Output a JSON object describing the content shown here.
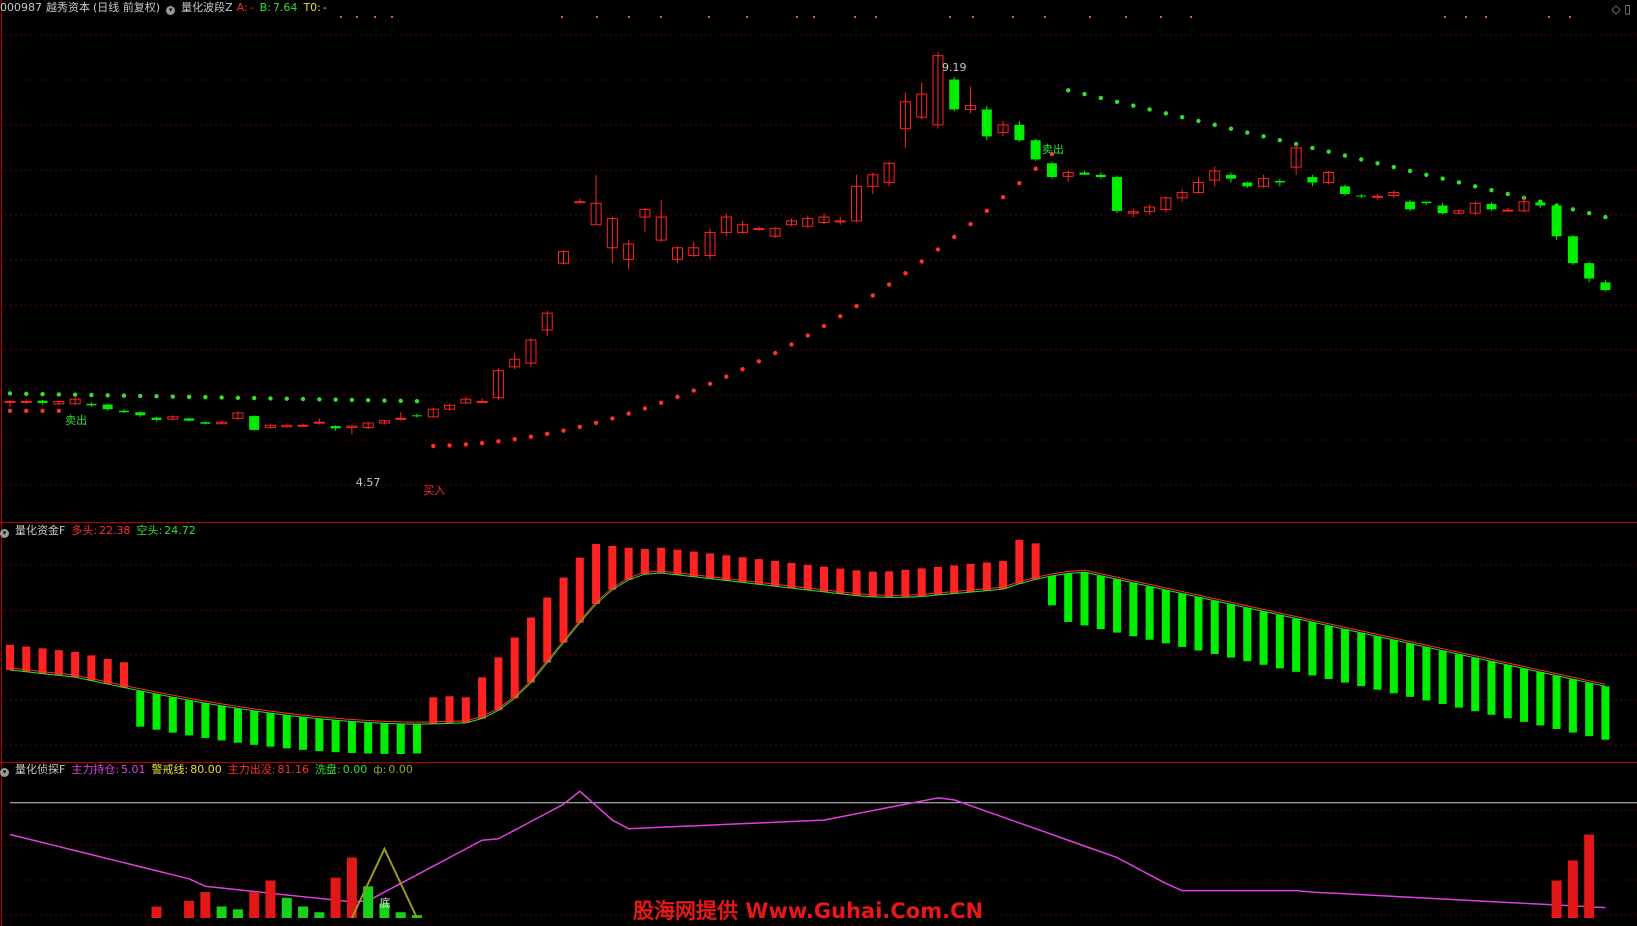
{
  "header": {
    "code": "000987",
    "name": "越秀资本",
    "mode": "(日线 前复权)",
    "indicator": "量化波段Z",
    "a_label": "A:",
    "a_value": "-",
    "b_label": "B:",
    "b_value": "7.64",
    "t0_label": "T0:",
    "t0_value": "-"
  },
  "panel2": {
    "indicator": "量化资金F",
    "long_label": "多头:",
    "long_value": "22.38",
    "short_label": "空头:",
    "short_value": "24.72"
  },
  "panel3": {
    "indicator": "量化侦探F",
    "hold_label": "主力持仓:",
    "hold_value": "5.01",
    "warn_label": "警戒线:",
    "warn_value": "80.00",
    "exit_label": "主力出没:",
    "exit_value": "81.16",
    "wash_label": "洗盘:",
    "wash_value": "0.00",
    "f_label": "ф:",
    "f_value": "0.00"
  },
  "watermark": "股海网提供 Www.Guhai.Com.CN",
  "colors": {
    "up": "#ff2222",
    "down": "#00ee00",
    "magenta": "#e040e0",
    "white": "#cccccc",
    "dotred": "#ff3030",
    "dotgreen": "#30e030",
    "olive": "#9a9a20",
    "bg": "#000000",
    "grid": "#5a0000"
  },
  "chart_data": [
    {
      "type": "candlestick",
      "price_range": [
        3.9,
        9.6
      ],
      "annotations": [
        {
          "text": "9.19",
          "index": 57,
          "value": 9.19
        },
        {
          "text": "4.57",
          "index": 21,
          "value": 4.57
        },
        {
          "text": "买入",
          "index": 26,
          "value": 4.5
        },
        {
          "text": "卖出",
          "index": 4,
          "value": 5.1
        },
        {
          "text": "卖出",
          "index": 64,
          "value": 8.4
        }
      ],
      "candles": [
        [
          5.0,
          5.0,
          5.02,
          4.93
        ],
        [
          5.0,
          5.0,
          5.03,
          4.97
        ],
        [
          5.01,
          4.98,
          5.02,
          4.96
        ],
        [
          4.97,
          5.0,
          5.01,
          4.95
        ],
        [
          4.97,
          5.03,
          5.05,
          4.95
        ],
        [
          4.97,
          4.95,
          4.99,
          4.93
        ],
        [
          4.96,
          4.9,
          4.97,
          4.88
        ],
        [
          4.88,
          4.86,
          4.9,
          4.85
        ],
        [
          4.86,
          4.82,
          4.87,
          4.8
        ],
        [
          4.79,
          4.76,
          4.8,
          4.74
        ],
        [
          4.77,
          4.8,
          4.82,
          4.76
        ],
        [
          4.78,
          4.75,
          4.79,
          4.74
        ],
        [
          4.73,
          4.71,
          4.74,
          4.7
        ],
        [
          4.71,
          4.73,
          4.75,
          4.7
        ],
        [
          4.78,
          4.85,
          4.87,
          4.76
        ],
        [
          4.81,
          4.63,
          4.82,
          4.62
        ],
        [
          4.66,
          4.69,
          4.7,
          4.65
        ],
        [
          4.67,
          4.69,
          4.7,
          4.66
        ],
        [
          4.69,
          4.69,
          4.71,
          4.67
        ],
        [
          4.73,
          4.73,
          4.78,
          4.7
        ],
        [
          4.68,
          4.65,
          4.69,
          4.62
        ],
        [
          4.66,
          4.68,
          4.69,
          4.57
        ],
        [
          4.66,
          4.72,
          4.73,
          4.64
        ],
        [
          4.72,
          4.75,
          4.76,
          4.7
        ],
        [
          4.78,
          4.78,
          4.86,
          4.75
        ],
        [
          4.82,
          4.81,
          4.84,
          4.79
        ],
        [
          4.8,
          4.9,
          4.92,
          4.79
        ],
        [
          4.9,
          4.95,
          4.97,
          4.88
        ],
        [
          4.98,
          5.03,
          5.06,
          4.97
        ],
        [
          5.0,
          5.0,
          5.04,
          4.98
        ],
        [
          5.05,
          5.4,
          5.43,
          5.02
        ],
        [
          5.45,
          5.55,
          5.63,
          5.42
        ],
        [
          5.5,
          5.8,
          5.82,
          5.45
        ],
        [
          5.93,
          6.15,
          6.18,
          5.85
        ],
        [
          6.8,
          6.95,
          6.97,
          6.78
        ],
        [
          7.6,
          7.6,
          7.64,
          7.6
        ],
        [
          7.3,
          7.58,
          7.95,
          7.3
        ],
        [
          7.0,
          7.38,
          7.4,
          6.8
        ],
        [
          6.85,
          7.05,
          7.1,
          6.72
        ],
        [
          7.4,
          7.5,
          7.52,
          7.2
        ],
        [
          7.1,
          7.4,
          7.62,
          7.07
        ],
        [
          6.85,
          7.0,
          7.02,
          6.8
        ],
        [
          6.9,
          7.0,
          7.08,
          6.88
        ],
        [
          6.9,
          7.2,
          7.25,
          6.85
        ],
        [
          7.2,
          7.4,
          7.45,
          7.15
        ],
        [
          7.2,
          7.3,
          7.35,
          7.18
        ],
        [
          7.25,
          7.25,
          7.28,
          7.22
        ],
        [
          7.15,
          7.25,
          7.27,
          7.13
        ],
        [
          7.3,
          7.35,
          7.38,
          7.28
        ],
        [
          7.28,
          7.38,
          7.42,
          7.26
        ],
        [
          7.33,
          7.4,
          7.45,
          7.31
        ],
        [
          7.35,
          7.35,
          7.4,
          7.3
        ],
        [
          7.35,
          7.8,
          7.95,
          7.33
        ],
        [
          7.8,
          7.95,
          7.98,
          7.7
        ],
        [
          7.85,
          8.1,
          8.12,
          7.8
        ],
        [
          8.55,
          8.9,
          9.02,
          8.3
        ],
        [
          8.7,
          9.0,
          9.15,
          8.67
        ],
        [
          8.6,
          9.5,
          9.55,
          8.55
        ],
        [
          9.19,
          8.8,
          9.22,
          8.78
        ],
        [
          8.8,
          8.85,
          9.1,
          8.75
        ],
        [
          8.8,
          8.45,
          8.85,
          8.4
        ],
        [
          8.5,
          8.6,
          8.65,
          8.45
        ],
        [
          8.6,
          8.4,
          8.65,
          8.38
        ],
        [
          8.4,
          8.15,
          8.42,
          8.13
        ],
        [
          8.1,
          7.92,
          8.12,
          7.9
        ],
        [
          7.93,
          7.98,
          8.01,
          7.86
        ],
        [
          7.98,
          7.95,
          8.0,
          7.95
        ],
        [
          7.95,
          7.92,
          7.98,
          7.9
        ],
        [
          7.92,
          7.48,
          7.94,
          7.45
        ],
        [
          7.45,
          7.47,
          7.51,
          7.4
        ],
        [
          7.47,
          7.53,
          7.56,
          7.43
        ],
        [
          7.5,
          7.65,
          7.67,
          7.46
        ],
        [
          7.65,
          7.72,
          7.76,
          7.6
        ],
        [
          7.72,
          7.85,
          7.92,
          7.7
        ],
        [
          7.88,
          8.0,
          8.06,
          7.8
        ],
        [
          7.95,
          7.9,
          7.98,
          7.85
        ],
        [
          7.85,
          7.8,
          7.86,
          7.78
        ],
        [
          7.8,
          7.9,
          7.95,
          7.78
        ],
        [
          7.87,
          7.85,
          7.9,
          7.8
        ],
        [
          8.05,
          8.3,
          8.35,
          7.95
        ],
        [
          7.92,
          7.85,
          7.95,
          7.8
        ],
        [
          7.85,
          7.98,
          8.0,
          7.83
        ],
        [
          7.8,
          7.7,
          7.82,
          7.68
        ],
        [
          7.68,
          7.67,
          7.7,
          7.65
        ],
        [
          7.66,
          7.67,
          7.7,
          7.63
        ],
        [
          7.68,
          7.72,
          7.75,
          7.65
        ],
        [
          7.6,
          7.5,
          7.62,
          7.48
        ],
        [
          7.6,
          7.58,
          7.6,
          7.56
        ],
        [
          7.55,
          7.45,
          7.58,
          7.43
        ],
        [
          7.45,
          7.48,
          7.5,
          7.43
        ],
        [
          7.45,
          7.58,
          7.6,
          7.43
        ],
        [
          7.57,
          7.5,
          7.59,
          7.48
        ],
        [
          7.49,
          7.49,
          7.52,
          7.47
        ],
        [
          7.48,
          7.6,
          7.68,
          7.46
        ],
        [
          7.59,
          7.55,
          7.61,
          7.52
        ],
        [
          7.55,
          7.15,
          7.58,
          7.1
        ],
        [
          7.15,
          6.8,
          7.17,
          6.78
        ],
        [
          6.8,
          6.6,
          6.82,
          6.55
        ],
        [
          6.55,
          6.45,
          6.58,
          6.43
        ]
      ]
    },
    {
      "type": "bar",
      "title": "量化资金F",
      "range": [
        0,
        100
      ],
      "series": [
        {
          "name": "多头",
          "values": [
            30
          ]
        },
        {
          "name": "空头",
          "values": [
            30
          ]
        }
      ]
    },
    {
      "type": "line",
      "title": "量化侦探F",
      "warn_line": 80,
      "range": [
        0,
        100
      ]
    }
  ]
}
